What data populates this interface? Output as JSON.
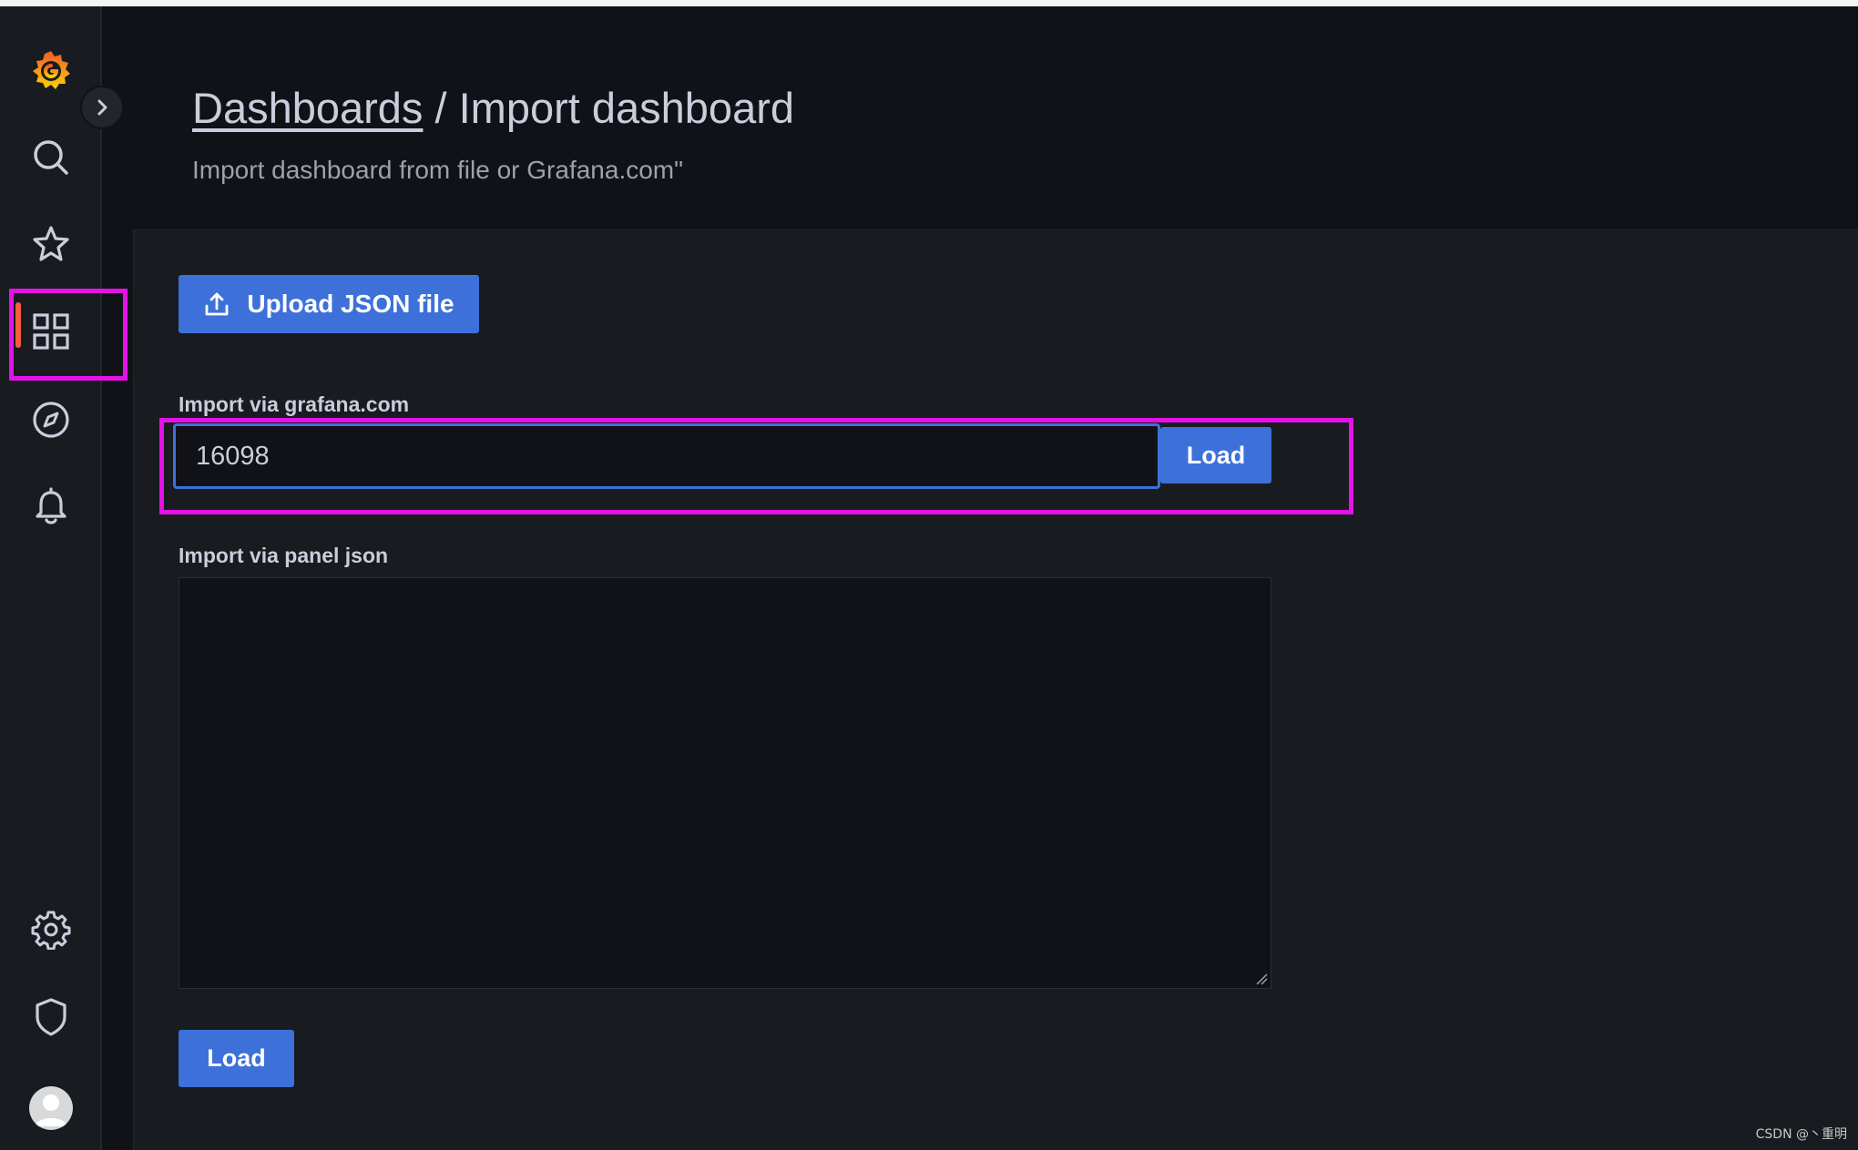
{
  "header": {
    "breadcrumb_parent": "Dashboards",
    "breadcrumb_separator": " / ",
    "breadcrumb_current": "Import dashboard",
    "subtitle": "Import dashboard from file or Grafana.com\""
  },
  "sidebar": {
    "items": [
      {
        "icon": "grafana-logo-icon"
      },
      {
        "icon": "search-icon"
      },
      {
        "icon": "star-icon"
      },
      {
        "icon": "dashboards-grid-icon",
        "active": true
      },
      {
        "icon": "explore-compass-icon"
      },
      {
        "icon": "alerting-bell-icon"
      },
      {
        "icon": "gear-icon"
      },
      {
        "icon": "shield-icon"
      },
      {
        "icon": "avatar-icon"
      }
    ],
    "expand_icon": "chevron-right-icon",
    "active_color": "#f55f3e"
  },
  "upload": {
    "label": "Upload JSON file",
    "icon": "upload-icon"
  },
  "grafana_import": {
    "label": "Import via grafana.com",
    "value": "16098",
    "load_label": "Load"
  },
  "panel_json": {
    "label": "Import via panel json",
    "value": "",
    "load_label": "Load"
  },
  "colors": {
    "primary": "#3d71d9",
    "annotation": "#e312e6",
    "background": "#111217",
    "panel": "#181b1f"
  },
  "watermark": "CSDN @丶重明"
}
